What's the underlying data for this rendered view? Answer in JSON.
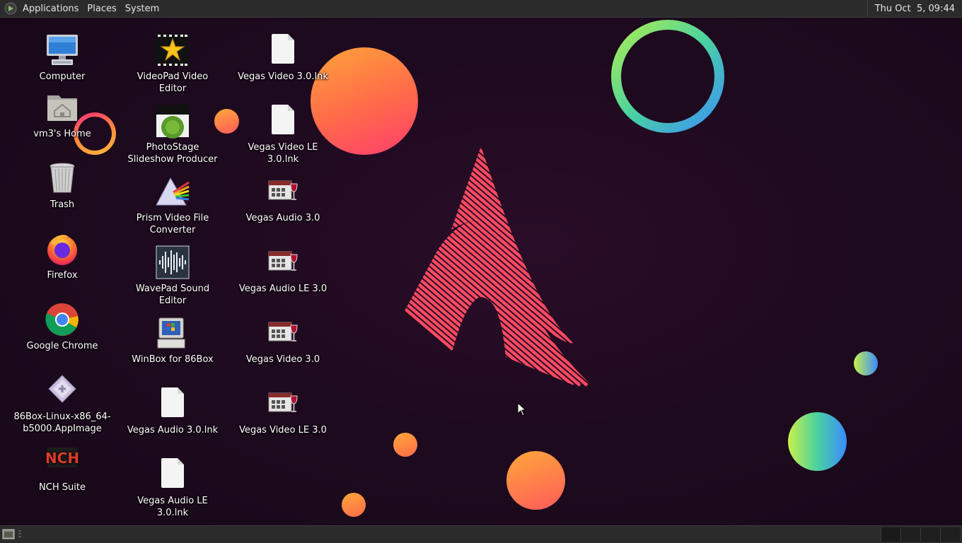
{
  "top_panel": {
    "menus": [
      "Applications",
      "Places",
      "System"
    ],
    "clock": "Thu Oct  5, 09:44"
  },
  "desktop_icons": [
    {
      "label": "Computer",
      "icon": "computer-icon"
    },
    {
      "label": "vm3's Home",
      "icon": "home-folder-icon"
    },
    {
      "label": "Trash",
      "icon": "trash-icon"
    },
    {
      "label": "Firefox",
      "icon": "firefox-icon"
    },
    {
      "label": "Google Chrome",
      "icon": "chrome-icon"
    },
    {
      "label": "86Box-Linux-x86_64-b5000.AppImage",
      "icon": "appimage-icon"
    },
    {
      "label": "NCH Suite",
      "icon": "nch-icon"
    },
    {
      "label": "VideoPad Video Editor",
      "icon": "videopad-icon"
    },
    {
      "label": "PhotoStage Slideshow Producer",
      "icon": "photostage-icon"
    },
    {
      "label": "Prism Video File Converter",
      "icon": "prism-icon"
    },
    {
      "label": "WavePad Sound Editor",
      "icon": "wavepad-icon"
    },
    {
      "label": "WinBox for 86Box",
      "icon": "winbox-icon"
    },
    {
      "label": "Vegas Audio 3.0.lnk",
      "icon": "file-icon"
    },
    {
      "label": "Vegas Audio LE 3.0.lnk",
      "icon": "file-icon"
    },
    {
      "label": "Vegas Video 3.0.lnk",
      "icon": "file-icon"
    },
    {
      "label": "Vegas Video LE 3.0.lnk",
      "icon": "file-icon"
    },
    {
      "label": "Vegas Audio 3.0",
      "icon": "wine-app-icon"
    },
    {
      "label": "Vegas Audio LE 3.0",
      "icon": "wine-app-icon"
    },
    {
      "label": "Vegas Video 3.0",
      "icon": "wine-app-icon"
    },
    {
      "label": "Vegas Video LE 3.0",
      "icon": "wine-app-icon"
    }
  ],
  "colors": {
    "panel": "#2b2b2b",
    "background": "#1e0a1f",
    "accent_orange": "#ff8a3d",
    "accent_pink": "#ff2a7a"
  }
}
